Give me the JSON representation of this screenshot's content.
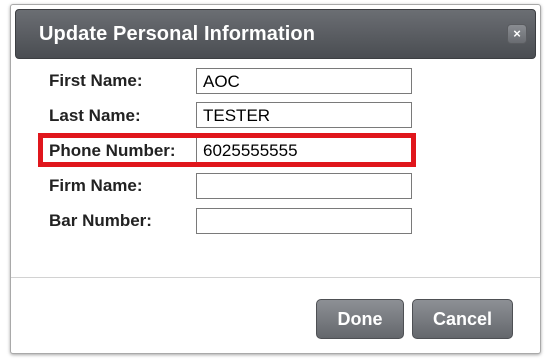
{
  "dialog": {
    "title": "Update Personal Information",
    "close_glyph": "×"
  },
  "form": {
    "first_name": {
      "label": "First Name:",
      "value": "AOC"
    },
    "last_name": {
      "label": "Last Name:",
      "value": "TESTER"
    },
    "phone_number": {
      "label": "Phone Number:",
      "value": "6025555555"
    },
    "firm_name": {
      "label": "Firm Name:",
      "value": ""
    },
    "bar_number": {
      "label": "Bar Number:",
      "value": ""
    }
  },
  "buttons": {
    "done": "Done",
    "cancel": "Cancel"
  },
  "colors": {
    "highlight": "#e0161c",
    "titlebar": "#55585d"
  }
}
